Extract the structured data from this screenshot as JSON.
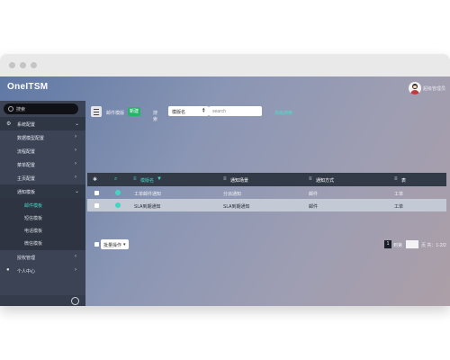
{
  "app": {
    "title": "OneITSM",
    "username": "超级管理员"
  },
  "sidebar": {
    "search_placeholder": "搜索",
    "items": [
      {
        "label": "系统配置",
        "expanded": true
      },
      {
        "label": "数据模型配置"
      },
      {
        "label": "流程配置"
      },
      {
        "label": "菜单配置"
      },
      {
        "label": "主页配置"
      },
      {
        "label": "通知模板",
        "expanded": true,
        "children": [
          {
            "label": "邮件模板",
            "selected": true
          },
          {
            "label": "短信模板"
          },
          {
            "label": "电话模板"
          },
          {
            "label": "微信模板"
          }
        ]
      },
      {
        "label": "授权管理"
      },
      {
        "label": "个人中心"
      }
    ]
  },
  "toolbar": {
    "title": "邮件模版",
    "new_label": "新建",
    "search_label": "搜索",
    "select_value": "模版名",
    "search_placeholder": "search",
    "advanced_link": "高级搜索"
  },
  "table": {
    "headers": [
      "模版名",
      "通知场景",
      "通知方式",
      "表"
    ],
    "rows": [
      [
        "工单邮件通知",
        "分派通知",
        "邮件",
        "工单"
      ],
      [
        "SLA到期通知",
        "SLA到期通知",
        "邮件",
        "工单"
      ]
    ]
  },
  "footer": {
    "batch_label": "批量操作",
    "page_number": "1",
    "jump_label": "到第",
    "page_suffix": "页",
    "total": "共：1-2/2"
  },
  "colors": {
    "accent": "#41d6c4",
    "new_button": "#27b46a",
    "sidebar_bg": "#3b4354",
    "header_bg": "#333a47"
  }
}
